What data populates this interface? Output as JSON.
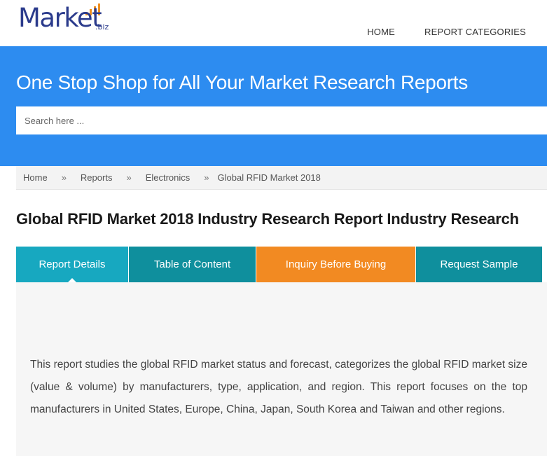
{
  "brand": {
    "logo_word": "Market",
    "logo_suffix": ".biz",
    "accent_colors": {
      "logo_text": "#2b3b8c",
      "logo_bars": "#f0901f",
      "hero_bg": "#2d8cf0"
    }
  },
  "nav": {
    "home": "HOME",
    "categories": "REPORT CATEGORIES"
  },
  "hero": {
    "title": "One Stop Shop for All Your Market Research Reports",
    "search_placeholder": "Search here ..."
  },
  "breadcrumb": {
    "items": [
      "Home",
      "Reports",
      "Electronics",
      "Global RFID Market 2018"
    ],
    "separator": "»"
  },
  "page": {
    "title": "Global RFID Market 2018 Industry Research Report Industry Research"
  },
  "tabs": [
    {
      "label": "Report Details",
      "active": true,
      "color": "#17a8c0"
    },
    {
      "label": "Table of Content",
      "active": false,
      "color": "#0f8f9d"
    },
    {
      "label": "Inquiry Before Buying",
      "active": false,
      "color": "#f28a22"
    },
    {
      "label": "Request Sample",
      "active": false,
      "color": "#0f8f9d"
    }
  ],
  "content": {
    "description": "This report studies the global RFID market status and forecast, categorizes the global RFID market size (value & volume) by manufacturers, type, application, and region. This report focuses on the top manufacturers in United States, Europe, China, Japan, South Korea and Taiwan and other regions."
  }
}
